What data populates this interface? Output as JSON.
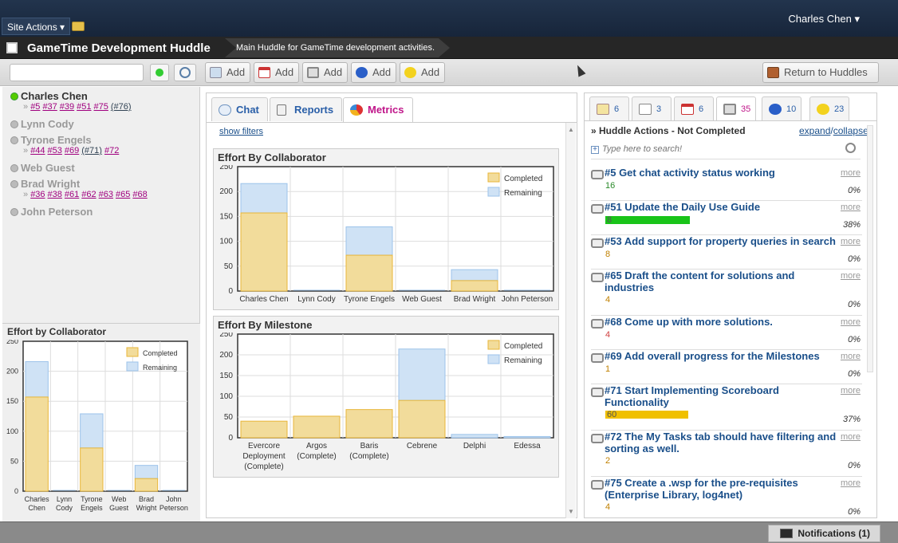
{
  "header": {
    "site_actions": "Site Actions",
    "user": "Charles Chen"
  },
  "huddle": {
    "title": "GameTime Development Huddle",
    "description": "Main Huddle for GameTime development activities."
  },
  "toolbar": {
    "add_label": "Add",
    "return_label": "Return to Huddles"
  },
  "sidebar": {
    "people": [
      {
        "name": "Charles Chen",
        "online": true,
        "tasks": [
          "#5",
          "#37",
          "#39",
          "#51",
          "#75",
          "(#76)"
        ]
      },
      {
        "name": "Lynn Cody",
        "online": false,
        "tasks": []
      },
      {
        "name": "Tyrone Engels",
        "online": false,
        "tasks": [
          "#44",
          "#53",
          "#69",
          "(#71)",
          "#72"
        ]
      },
      {
        "name": "Web Guest",
        "online": false,
        "tasks": []
      },
      {
        "name": "Brad Wright",
        "online": false,
        "tasks": [
          "#36",
          "#38",
          "#61",
          "#62",
          "#63",
          "#65",
          "#68"
        ]
      },
      {
        "name": "John Peterson",
        "online": false,
        "tasks": []
      }
    ],
    "chart_title": "Effort by Collaborator"
  },
  "center": {
    "tabs": [
      "Chat",
      "Reports",
      "Metrics"
    ],
    "show_filters": "show filters"
  },
  "right": {
    "tabs": [
      "6",
      "3",
      "6",
      "35",
      "10",
      "23"
    ],
    "heading": "» Huddle Actions - Not Completed",
    "expand": "expand",
    "slash": "/",
    "collapse": "collapse",
    "search_placeholder": "Type here to search!",
    "more_label": "more",
    "actions": [
      {
        "title": "#5 Get chat activity status working",
        "count": "16",
        "pct": "0%",
        "progress": 0,
        "color": "#2a8a2a"
      },
      {
        "title": "#51 Update the Daily Use Guide",
        "count": "8",
        "pct": "38%",
        "progress": 1,
        "color": "#19c419"
      },
      {
        "title": "#53 Add support for property queries in search",
        "count": "8",
        "pct": "0%",
        "progress": 0,
        "color": "#c08000"
      },
      {
        "title": "#65 Draft the content for solutions and industries",
        "count": "4",
        "pct": "0%",
        "progress": 0,
        "color": "#c08000"
      },
      {
        "title": "#68 Come up with more solutions.",
        "count": "4",
        "pct": "0%",
        "progress": 0,
        "color": "#d04040"
      },
      {
        "title": "#69 Add overall progress for the Milestones",
        "count": "1",
        "pct": "0%",
        "progress": 0,
        "color": "#c08000"
      },
      {
        "title": "#71 Start Implementing Scoreboard Functionality",
        "count": "60",
        "pct": "37%",
        "progress": 1,
        "color": "#f0c000"
      },
      {
        "title": "#72 The My Tasks tab should have filtering and sorting as well.",
        "count": "2",
        "pct": "0%",
        "progress": 0,
        "color": "#c08000"
      },
      {
        "title": "#75 Create a .wsp for the pre-requisites (Enterprise Library, log4net)",
        "count": "4",
        "pct": "0%",
        "progress": 0,
        "color": "#c08000"
      }
    ]
  },
  "notifications": "Notifications (1)",
  "colors": {
    "completed": "#f2dc9b",
    "completed_border": "#e8b63a",
    "remaining": "#cfe2f5",
    "remaining_border": "#9cc3ea"
  },
  "chart_data": [
    {
      "type": "bar",
      "stacked": true,
      "title": "Effort By Collaborator",
      "categories": [
        "Charles Chen",
        "Lynn Cody",
        "Tyrone Engels",
        "Web Guest",
        "Brad Wright",
        "John Peterson"
      ],
      "series": [
        {
          "name": "Completed",
          "values": [
            157,
            0,
            72,
            0,
            21,
            0
          ]
        },
        {
          "name": "Remaining",
          "values": [
            59,
            0,
            57,
            0,
            22,
            0
          ]
        }
      ],
      "ylim": [
        0,
        250
      ],
      "yticks": [
        0,
        50,
        100,
        150,
        200,
        250
      ],
      "grid": true,
      "legend": "top-right"
    },
    {
      "type": "bar",
      "stacked": true,
      "title": "Effort By Milestone",
      "categories": [
        "Evercore Deployment (Complete)",
        "Argos (Complete)",
        "Baris (Complete)",
        "Cebrene",
        "Delphi",
        "Edessa"
      ],
      "series": [
        {
          "name": "Completed",
          "values": [
            40,
            52,
            68,
            90,
            0,
            0
          ]
        },
        {
          "name": "Remaining",
          "values": [
            0,
            0,
            0,
            124,
            8,
            3
          ]
        }
      ],
      "ylim": [
        0,
        250
      ],
      "yticks": [
        0,
        50,
        100,
        150,
        200,
        250
      ],
      "grid": true,
      "legend": "top-right"
    },
    {
      "type": "bar",
      "stacked": true,
      "title": "Effort by Collaborator",
      "categories": [
        "Charles Chen",
        "Lynn Cody",
        "Tyrone Engels",
        "Web Guest",
        "Brad Wright",
        "John Peterson"
      ],
      "series": [
        {
          "name": "Completed",
          "values": [
            157,
            0,
            72,
            0,
            21,
            0
          ]
        },
        {
          "name": "Remaining",
          "values": [
            59,
            0,
            57,
            0,
            22,
            0
          ]
        }
      ],
      "ylim": [
        0,
        250
      ],
      "yticks": [
        0,
        50,
        100,
        150,
        200,
        250
      ],
      "grid": true,
      "legend": "top-right"
    }
  ]
}
